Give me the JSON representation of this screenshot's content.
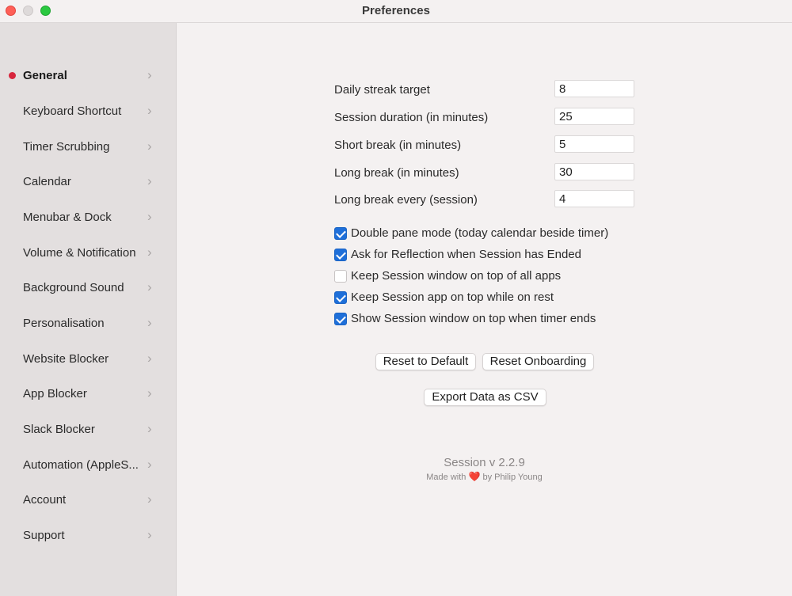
{
  "window": {
    "title": "Preferences"
  },
  "sidebar": {
    "items": [
      {
        "label": "General",
        "active": true
      },
      {
        "label": "Keyboard Shortcut"
      },
      {
        "label": "Timer Scrubbing"
      },
      {
        "label": "Calendar"
      },
      {
        "label": "Menubar & Dock"
      },
      {
        "label": "Volume & Notification"
      },
      {
        "label": "Background Sound"
      },
      {
        "label": "Personalisation"
      },
      {
        "label": "Website Blocker"
      },
      {
        "label": "App Blocker"
      },
      {
        "label": "Slack Blocker"
      },
      {
        "label": "Automation (AppleS..."
      },
      {
        "label": "Account"
      },
      {
        "label": "Support"
      }
    ],
    "chevron_icon": "chevron-right-icon",
    "active_dot_color": "#d7263d"
  },
  "general": {
    "fields": [
      {
        "label": "Daily streak target",
        "value": "8"
      },
      {
        "label": "Session duration (in minutes)",
        "value": "25"
      },
      {
        "label": "Short break (in minutes)",
        "value": "5"
      },
      {
        "label": "Long break (in minutes)",
        "value": "30"
      },
      {
        "label": "Long break every (session)",
        "value": "4"
      }
    ],
    "checkboxes": [
      {
        "label": "Double pane mode (today calendar beside timer)",
        "checked": true
      },
      {
        "label": "Ask for Reflection when Session has Ended",
        "checked": true
      },
      {
        "label": "Keep Session window on top of all apps",
        "checked": false
      },
      {
        "label": "Keep Session app on top while on rest",
        "checked": true
      },
      {
        "label": "Show Session window on top when timer ends",
        "checked": true
      }
    ],
    "buttons": {
      "reset_default": "Reset to Default",
      "reset_onboarding": "Reset Onboarding",
      "export_csv": "Export Data as CSV"
    },
    "footer": {
      "version": "Session v 2.2.9",
      "made_with_prefix": "Made with",
      "heart": "❤️",
      "made_with_suffix": "by Philip Young"
    }
  },
  "colors": {
    "accent": "#1e6fd9",
    "close": "#fe5f57",
    "maximize": "#2ac840"
  }
}
